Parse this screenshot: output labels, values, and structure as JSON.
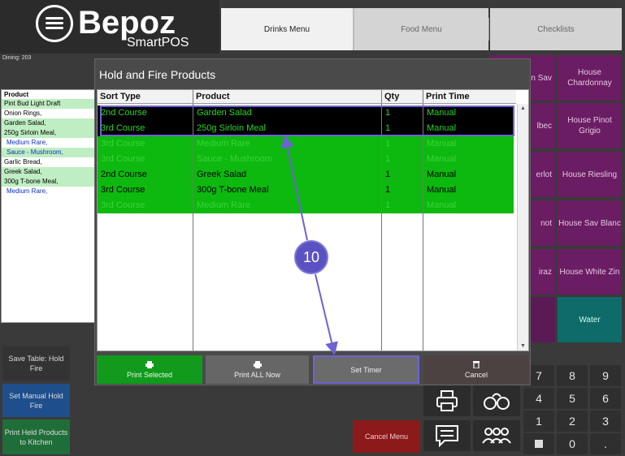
{
  "brand": {
    "name": "Bepoz",
    "sub": "SmartPOS"
  },
  "table_label": "Dining: 203",
  "top_tabs": [
    "Drinks Menu",
    "Food Menu",
    "Checklists"
  ],
  "order_list": {
    "header": "Product",
    "lines": [
      "Pint Bud Light Draft",
      "Onion Rings,",
      "Garden Salad,",
      "250g Sirloin Meal,",
      "Medium Rare,",
      "Sauce - Mushroom,",
      "Garlic Bread,",
      "Greek Salad,",
      "300g T-bone Meal,",
      "Medium Rare,"
    ]
  },
  "left_buttons": [
    "Save Table: Hold Fire",
    "Set Manual Hold Fire",
    "Print Held Products to Kitchen"
  ],
  "products": [
    "House Chardonnay",
    "House Pinot Grigio",
    "House Riesling",
    "House Sav Blanc",
    "House White Zin",
    "Water"
  ],
  "partial_products": [
    "n Sav",
    "lbec",
    "erlot",
    "not",
    "iraz",
    ""
  ],
  "keypad": [
    "7",
    "8",
    "9",
    "4",
    "5",
    "6",
    "1",
    "2",
    "3",
    "0",
    "."
  ],
  "cancel_menu": "Cancel Menu",
  "dialog": {
    "title": "Hold and Fire Products",
    "columns": [
      "Sort Type",
      "Product",
      "Qty",
      "Print Time"
    ],
    "rows": [
      [
        "2nd Course",
        "Garden Salad",
        "1",
        "Manual"
      ],
      [
        "3rd Course",
        "250g Sirloin Meal",
        "1",
        "Manual"
      ],
      [
        "3rd Course",
        "Medium Rare",
        "1",
        "Manual"
      ],
      [
        "3rd Course",
        "Sauce - Mushroom",
        "1",
        "Manual"
      ],
      [
        "2nd Course",
        "Greek Salad",
        "1",
        "Manual"
      ],
      [
        "3rd Course",
        "300g T-bone Meal",
        "1",
        "Manual"
      ],
      [
        "3rd Course",
        "Medium Rare",
        "1",
        "Manual"
      ]
    ],
    "buttons": [
      "Print Selected",
      "Print ALL Now",
      "Set Timer",
      "Cancel"
    ]
  },
  "annotation": "10",
  "colors": {
    "selected_row": "#000000",
    "row_green": "#0db80f",
    "annotation": "#5a52c2"
  }
}
